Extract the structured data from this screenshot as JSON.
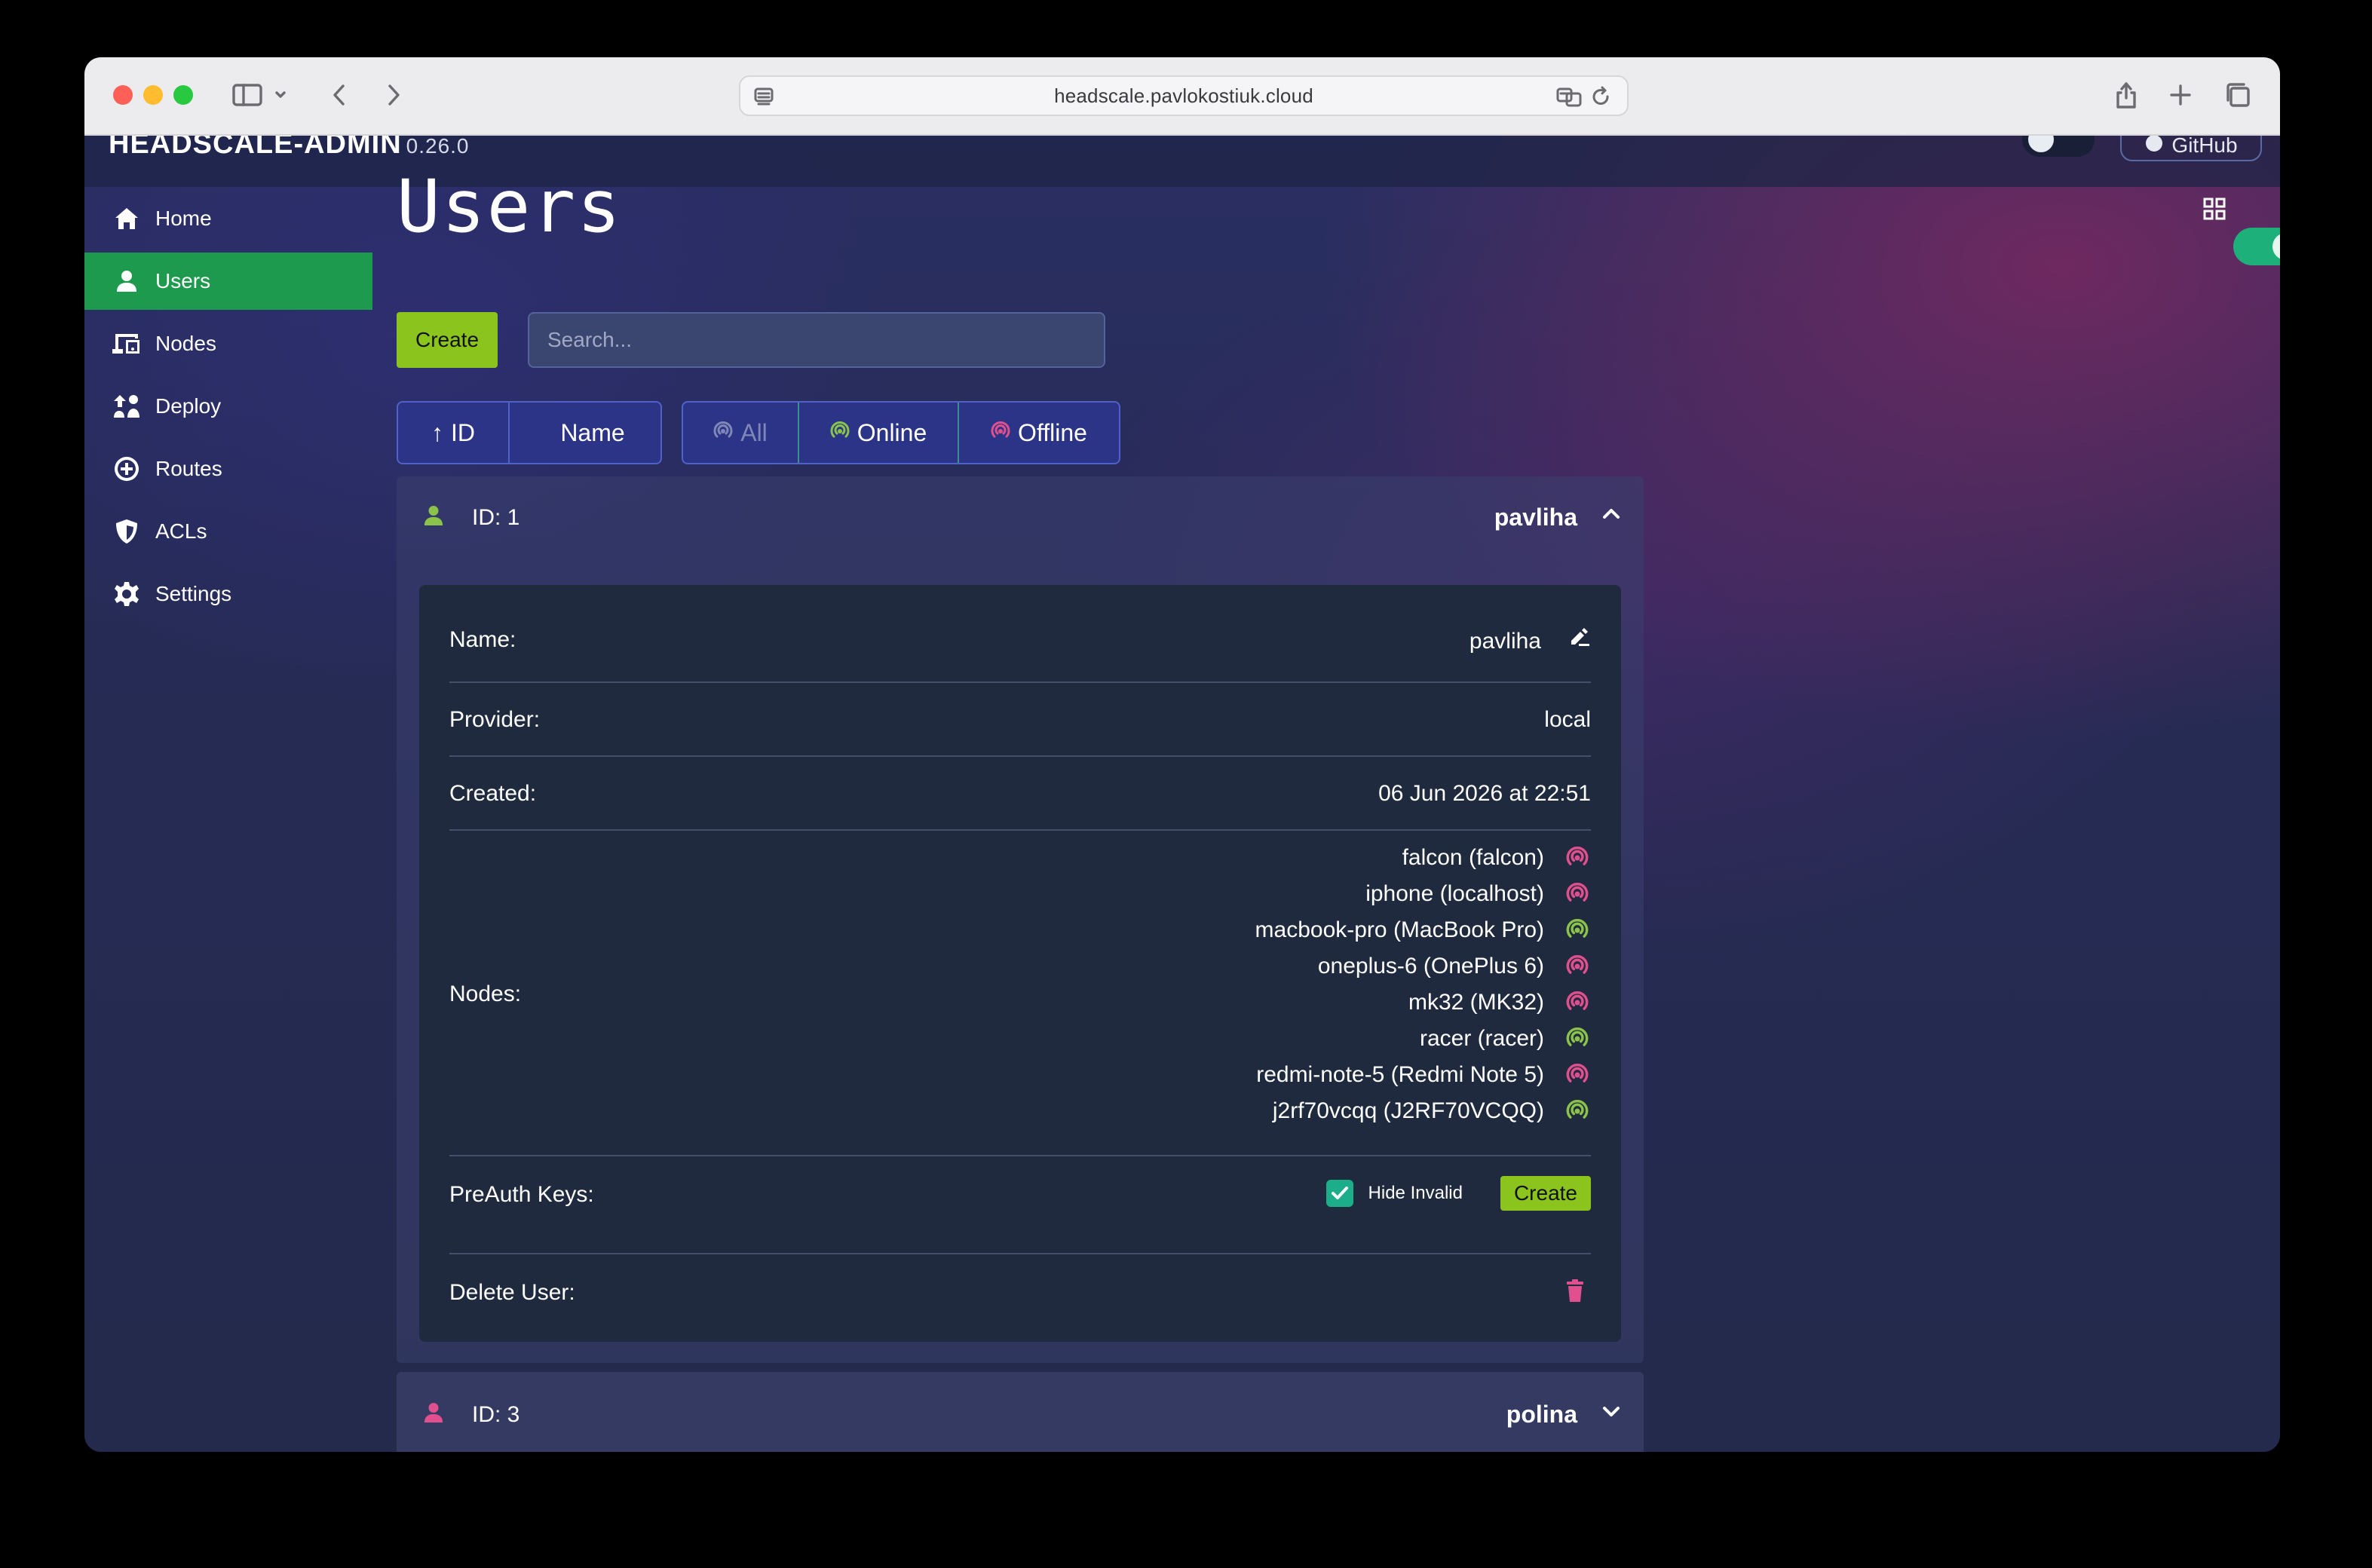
{
  "browser": {
    "url": "headscale.pavlokostiuk.cloud"
  },
  "header": {
    "brand": "HEADSCALE-ADMIN",
    "version": "0.26.0",
    "github_label": "GitHub"
  },
  "sidebar": {
    "items": [
      {
        "label": "Home",
        "icon": "home-icon",
        "active": false
      },
      {
        "label": "Users",
        "icon": "user-icon",
        "active": true
      },
      {
        "label": "Nodes",
        "icon": "devices-icon",
        "active": false
      },
      {
        "label": "Deploy",
        "icon": "deploy-icon",
        "active": false
      },
      {
        "label": "Routes",
        "icon": "routes-icon",
        "active": false
      },
      {
        "label": "ACLs",
        "icon": "shield-icon",
        "active": false
      },
      {
        "label": "Settings",
        "icon": "gear-icon",
        "active": false
      }
    ]
  },
  "main": {
    "title": "Users",
    "create_label": "Create",
    "search_placeholder": "Search...",
    "sort": {
      "id_label": "ID",
      "id_arrow": "↑",
      "name_label": "Name"
    },
    "filter": {
      "all_label": "All",
      "online_label": "Online",
      "offline_label": "Offline"
    }
  },
  "users": [
    {
      "id_label": "ID: 1",
      "name": "pavliha",
      "expanded": true,
      "details": {
        "name_label": "Name:",
        "name_value": "pavliha",
        "provider_label": "Provider:",
        "provider_value": "local",
        "created_label": "Created:",
        "created_value": "06 Jun 2026 at 22:51",
        "nodes_label": "Nodes:",
        "nodes": [
          {
            "label": "falcon (falcon)",
            "status": "offline"
          },
          {
            "label": "iphone (localhost)",
            "status": "offline"
          },
          {
            "label": "macbook-pro (MacBook Pro)",
            "status": "online"
          },
          {
            "label": "oneplus-6 (OnePlus 6)",
            "status": "offline"
          },
          {
            "label": "mk32 (MK32)",
            "status": "offline"
          },
          {
            "label": "racer (racer)",
            "status": "online"
          },
          {
            "label": "redmi-note-5 (Redmi Note 5)",
            "status": "offline"
          },
          {
            "label": "j2rf70vcqq (J2RF70VCQQ)",
            "status": "online"
          }
        ],
        "preauth_label": "PreAuth Keys:",
        "hide_invalid_label": "Hide Invalid",
        "hide_invalid_checked": true,
        "preauth_create_label": "Create",
        "delete_label": "Delete User:"
      }
    },
    {
      "id_label": "ID: 3",
      "name": "polina",
      "expanded": false
    }
  ],
  "colors": {
    "accent_green": "#8bc41c",
    "active_nav": "#1e9a4f",
    "online": "#8bc34a",
    "offline": "#e0508e",
    "toggle_on": "#1eb07a"
  }
}
